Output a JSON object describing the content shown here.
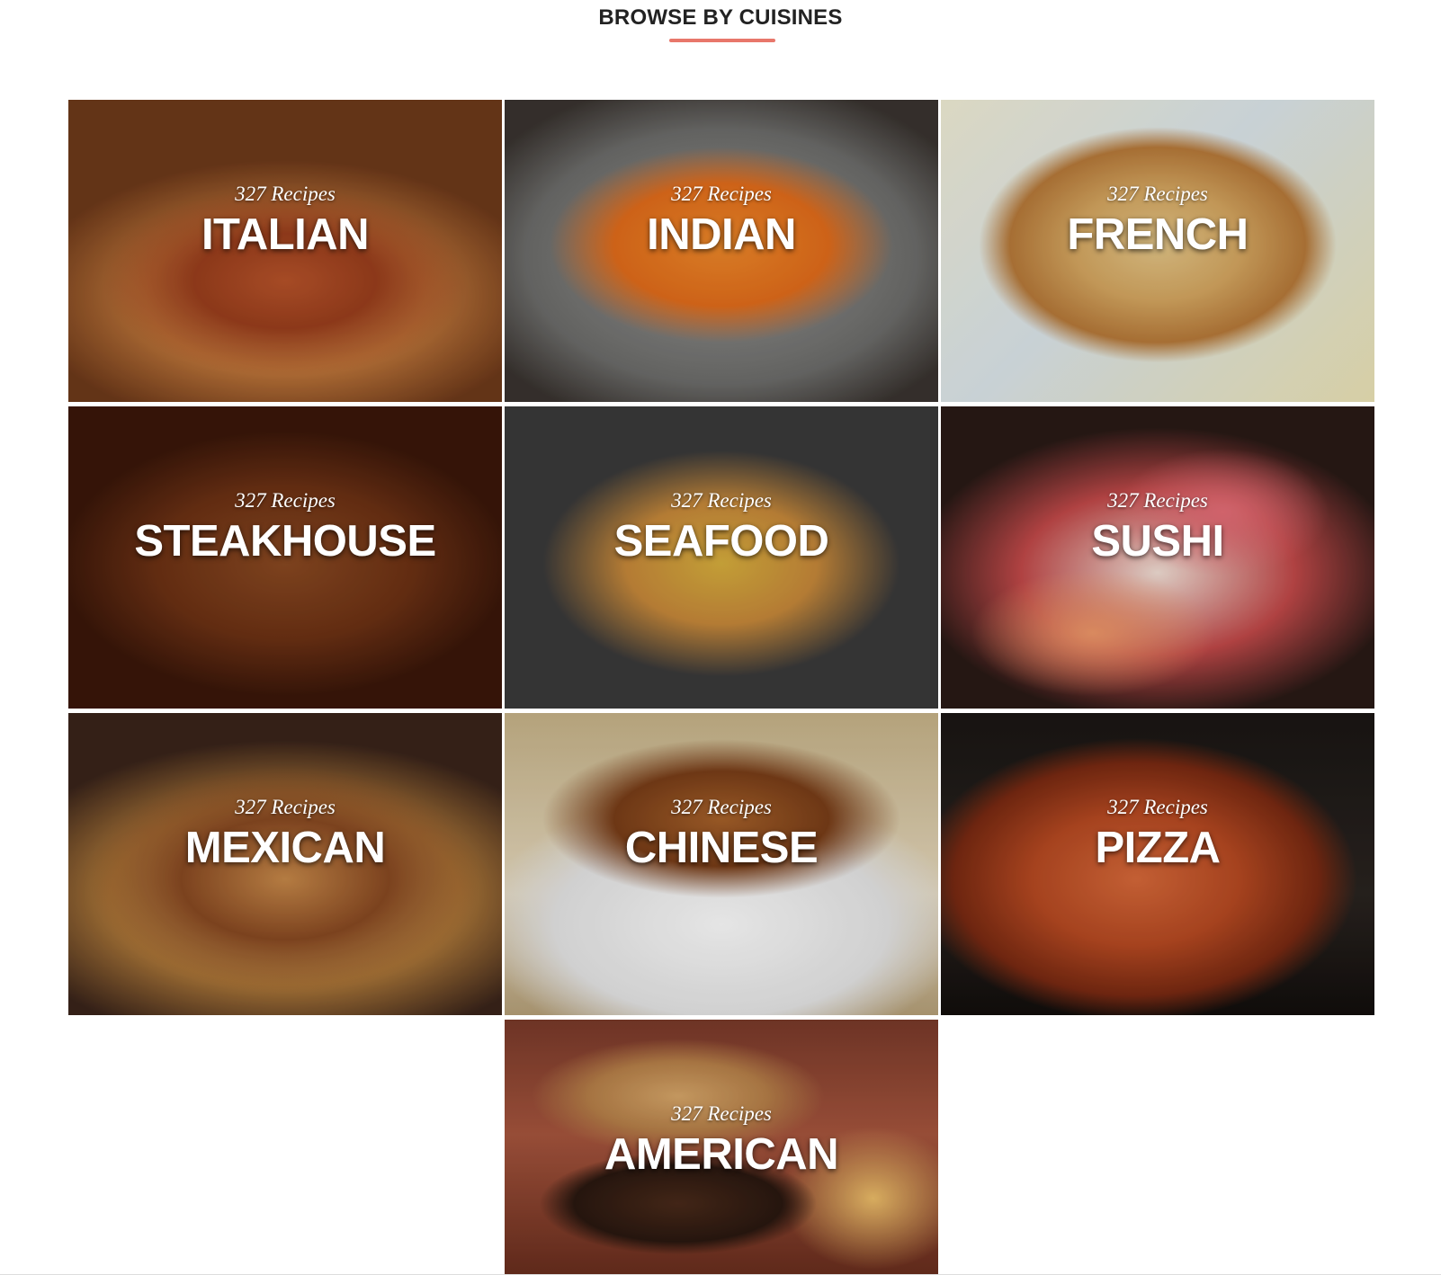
{
  "section": {
    "title": "BROWSE BY CUISINES",
    "accent_color": "#e8776b"
  },
  "cuisines": [
    {
      "name": "ITALIAN",
      "count": "327 Recipes"
    },
    {
      "name": "INDIAN",
      "count": "327 Recipes"
    },
    {
      "name": "FRENCH",
      "count": "327 Recipes"
    },
    {
      "name": "STEAKHOUSE",
      "count": "327 Recipes"
    },
    {
      "name": "SEAFOOD",
      "count": "327 Recipes"
    },
    {
      "name": "SUSHI",
      "count": "327 Recipes"
    },
    {
      "name": "MEXICAN",
      "count": "327 Recipes"
    },
    {
      "name": "CHINESE",
      "count": "327 Recipes"
    },
    {
      "name": "PIZZA",
      "count": "327 Recipes"
    },
    {
      "name": "AMERICAN",
      "count": "327 Recipes"
    }
  ]
}
